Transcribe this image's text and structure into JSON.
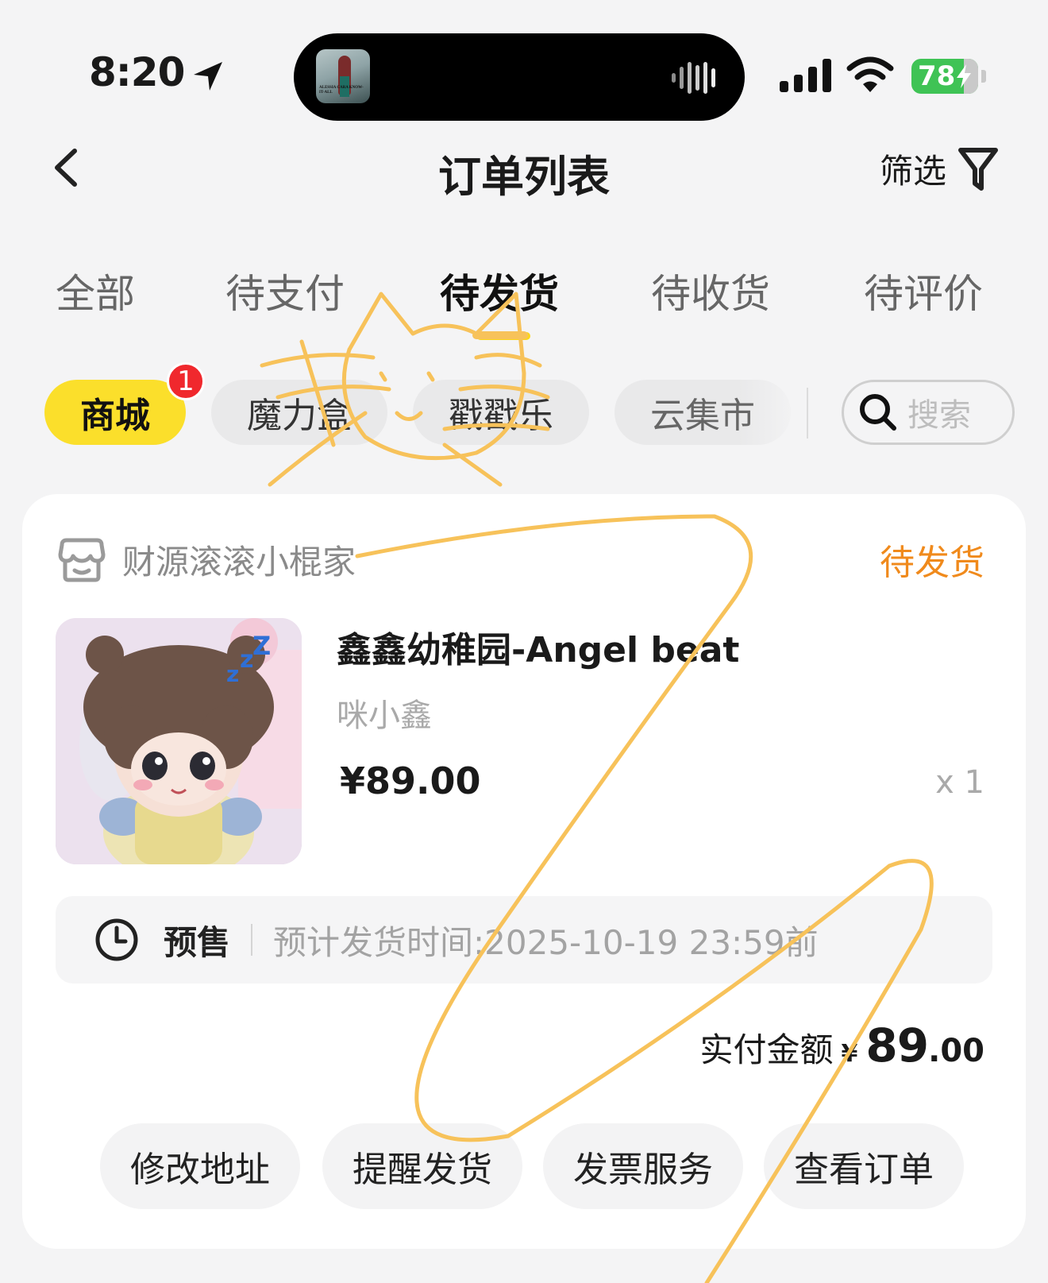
{
  "status_bar": {
    "time": "8:20",
    "battery": "78",
    "album_text": "ALESSIA CARA KNOW-IT-ALL"
  },
  "header": {
    "title": "订单列表",
    "filter_label": "筛选"
  },
  "tabs": [
    {
      "label": "全部",
      "active": false
    },
    {
      "label": "待支付",
      "active": false
    },
    {
      "label": "待发货",
      "active": true
    },
    {
      "label": "待收货",
      "active": false
    },
    {
      "label": "待评价",
      "active": false
    }
  ],
  "chips": [
    {
      "label": "商城",
      "active": true,
      "badge": "1"
    },
    {
      "label": "魔力盒",
      "active": false
    },
    {
      "label": "戳戳乐",
      "active": false
    },
    {
      "label": "云集市",
      "active": false
    }
  ],
  "search": {
    "placeholder": "搜索"
  },
  "order": {
    "shop_name": "财源滚滚小棍家",
    "status": "待发货",
    "product_title": "鑫鑫幼稚园-Angel beat",
    "product_subtitle": "咪小鑫",
    "price": "¥89.00",
    "quantity": "x 1",
    "presale_tag": "预售",
    "presale_eta": "预计发货时间:2025-10-19 23:59前",
    "paid_label": "实付金额",
    "paid_currency": "¥",
    "paid_amount": "89",
    "paid_decimals": ".00",
    "actions": [
      "修改地址",
      "提醒发货",
      "发票服务",
      "查看订单"
    ]
  },
  "colors": {
    "accent_yellow": "#fbdf2b",
    "status_orange": "#f08a1c",
    "badge_red": "#f0282d",
    "doodle": "#f7c25a"
  }
}
